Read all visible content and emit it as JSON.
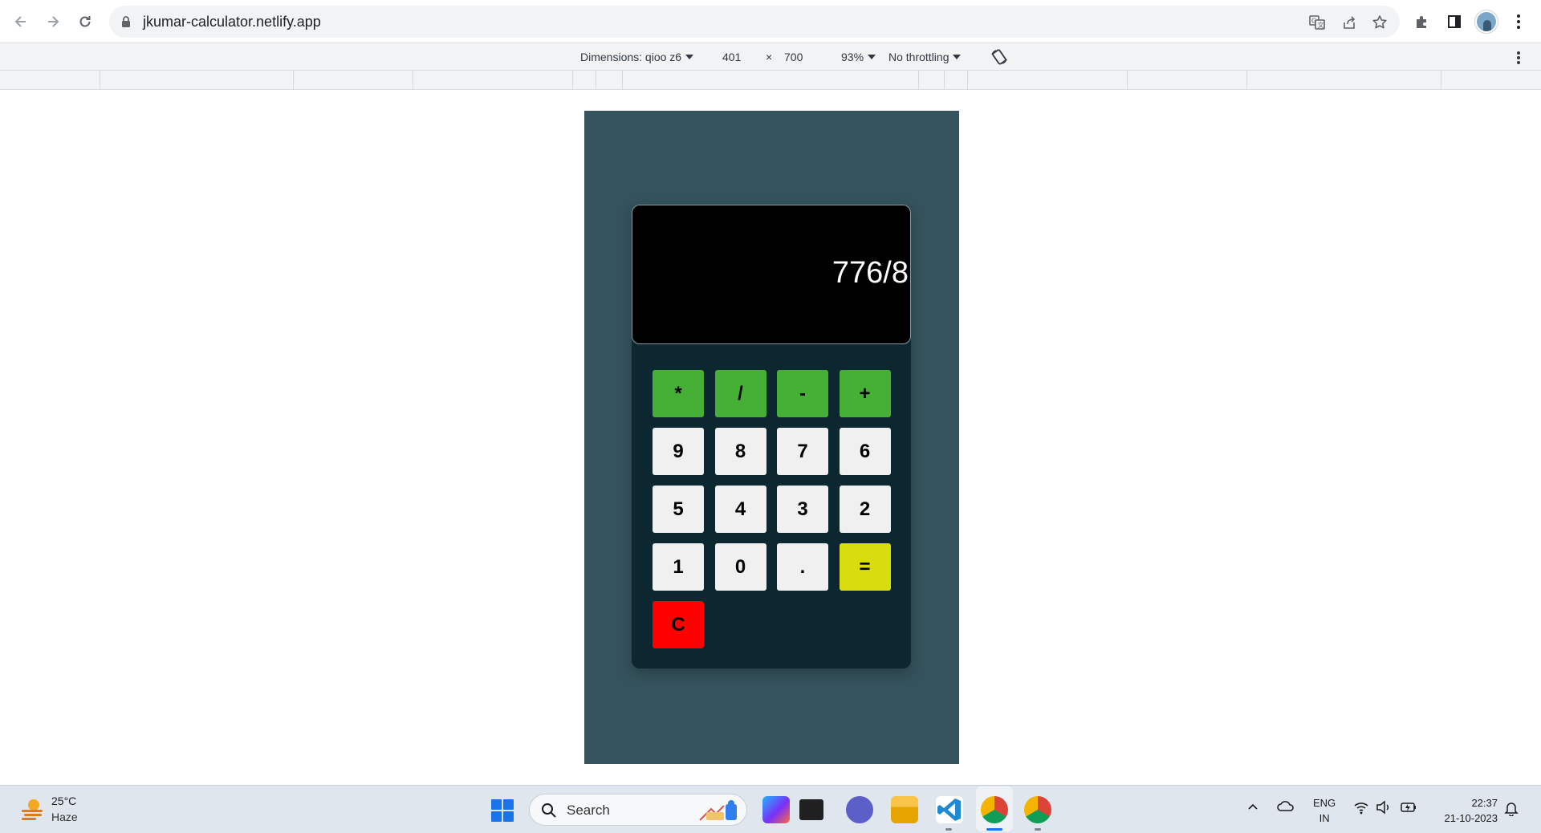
{
  "browser": {
    "url": "jkumar-calculator.netlify.app"
  },
  "devtools": {
    "dimensions_label": "Dimensions: qioo z6",
    "width": "401",
    "times": "×",
    "height": "700",
    "zoom": "93%",
    "throttling": "No throttling"
  },
  "calculator": {
    "display": "776/8",
    "keys": [
      {
        "label": "*",
        "kind": "operator"
      },
      {
        "label": "/",
        "kind": "operator"
      },
      {
        "label": "-",
        "kind": "operator"
      },
      {
        "label": "+",
        "kind": "operator"
      },
      {
        "label": "9",
        "kind": "digit"
      },
      {
        "label": "8",
        "kind": "digit"
      },
      {
        "label": "7",
        "kind": "digit"
      },
      {
        "label": "6",
        "kind": "digit"
      },
      {
        "label": "5",
        "kind": "digit"
      },
      {
        "label": "4",
        "kind": "digit"
      },
      {
        "label": "3",
        "kind": "digit"
      },
      {
        "label": "2",
        "kind": "digit"
      },
      {
        "label": "1",
        "kind": "digit"
      },
      {
        "label": "0",
        "kind": "digit"
      },
      {
        "label": ".",
        "kind": "digit"
      },
      {
        "label": "=",
        "kind": "equals"
      },
      {
        "label": "C",
        "kind": "clear"
      }
    ],
    "colors": {
      "operator": "#45b035",
      "digit": "#f0f0f0",
      "equals": "#d9dd10",
      "clear": "#ff0000",
      "body": "#0c2730",
      "page_bg": "#35535d"
    }
  },
  "taskbar": {
    "weather_temp": "25°C",
    "weather_desc": "Haze",
    "search_label": "Search",
    "lang_top": "ENG",
    "lang_bottom": "IN",
    "time": "22:37",
    "date": "21-10-2023"
  }
}
